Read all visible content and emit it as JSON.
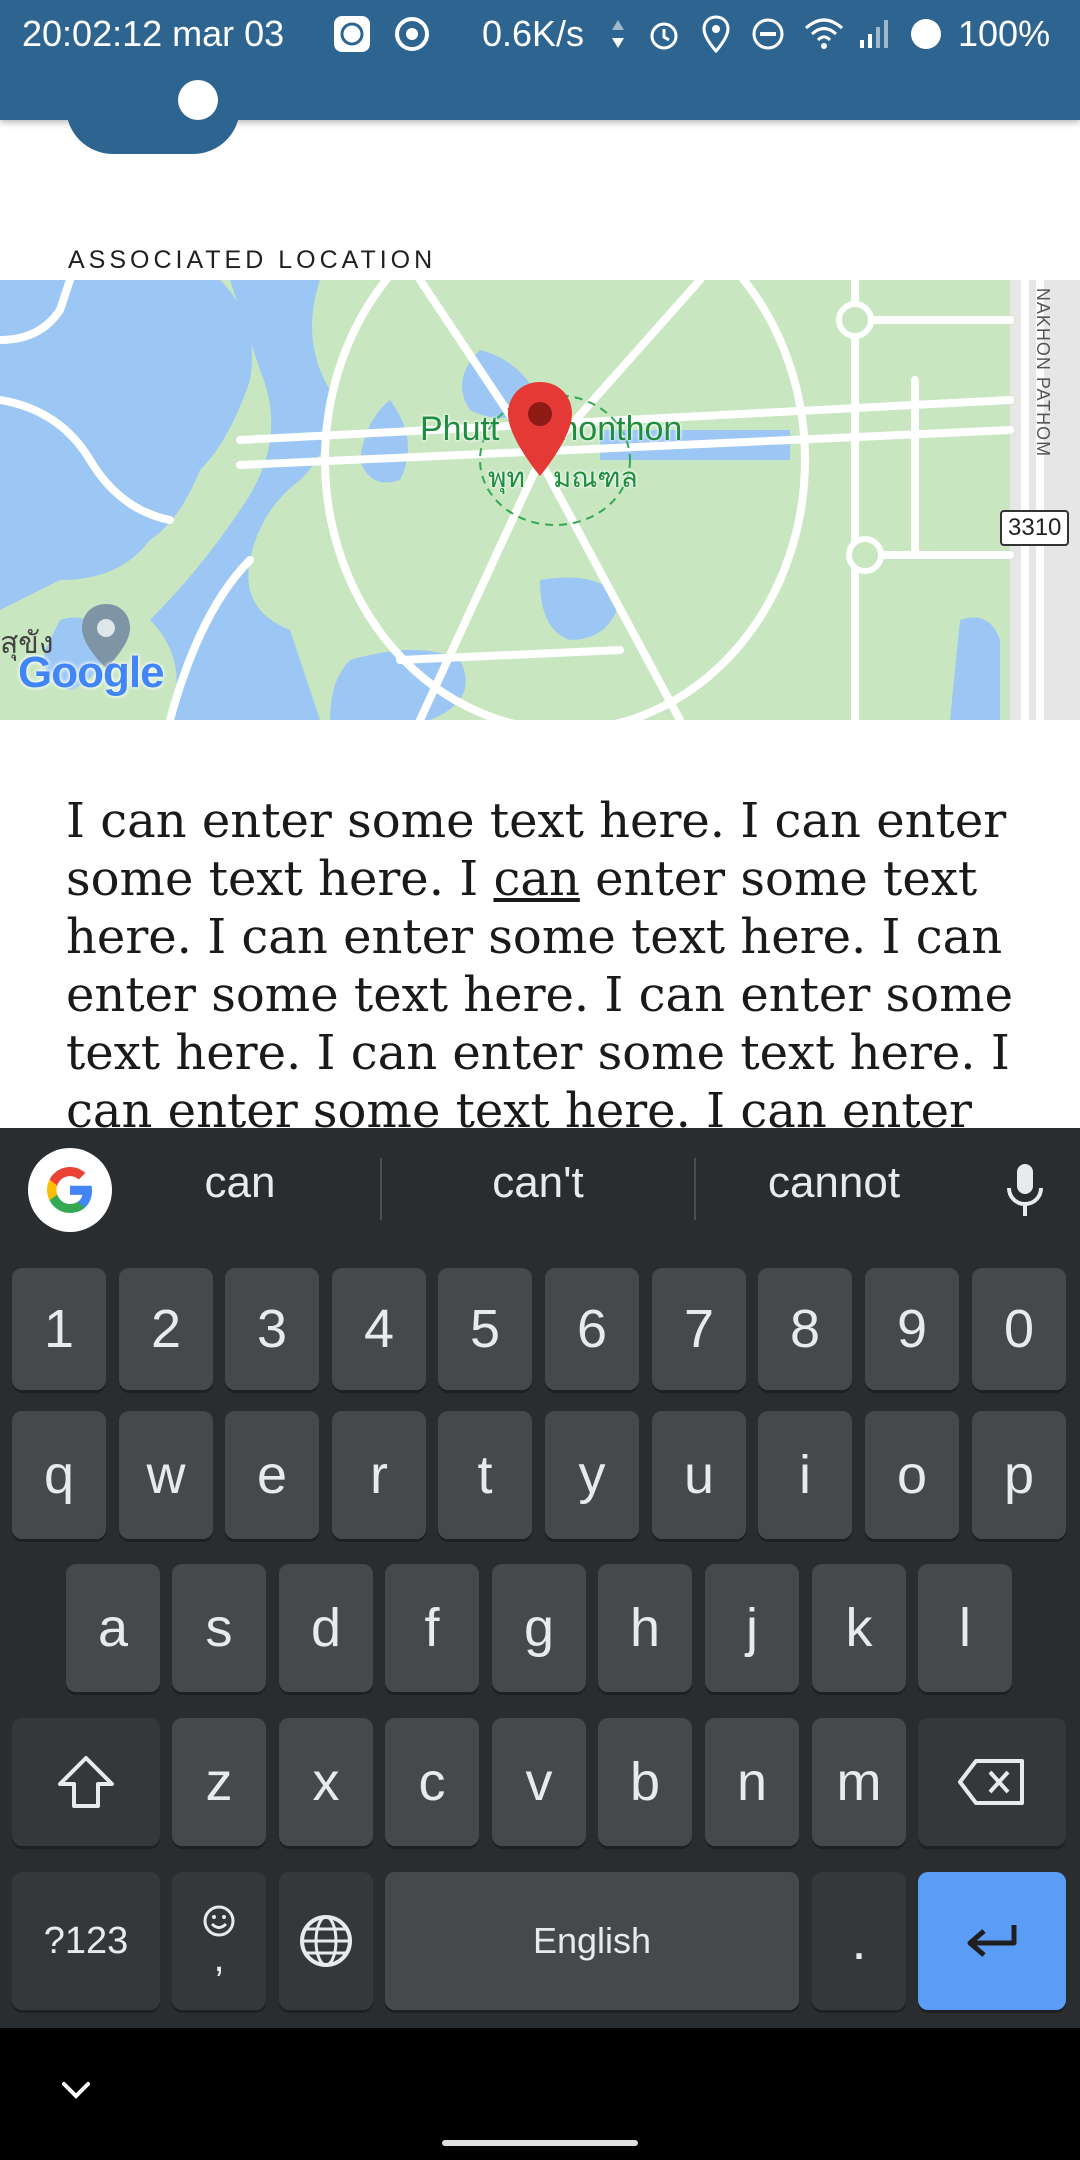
{
  "status_bar": {
    "time": "20:02:12 mar 03",
    "net_speed": "0.6K/s",
    "battery": "100%"
  },
  "section": {
    "label": "ASSOCIATED LOCATION"
  },
  "map": {
    "place_name": "Phutthamonthon",
    "place_name_visible_left": "Phutt",
    "place_name_visible_right": "nonthon",
    "place_name_thai_left": "พุท",
    "place_name_thai_right": "มณฑล",
    "edge_thai": "สุขัง",
    "road_label": "NAKHON PATHOM",
    "route_shield": "3310",
    "attribution": "Google"
  },
  "content": {
    "before_underline": "I can enter some text here. I can enter some text here. I ",
    "underlined_word": "can",
    "after_underline": " enter some text here. I can enter some text here. I can enter some text here. I can enter some text here. I can enter some text here. I can enter some text here. I can enter"
  },
  "keyboard": {
    "suggestions": [
      "can",
      "can't",
      "cannot"
    ],
    "row_numbers": [
      "1",
      "2",
      "3",
      "4",
      "5",
      "6",
      "7",
      "8",
      "9",
      "0"
    ],
    "row_top": [
      "q",
      "w",
      "e",
      "r",
      "t",
      "y",
      "u",
      "i",
      "o",
      "p"
    ],
    "row_middle": [
      "a",
      "s",
      "d",
      "f",
      "g",
      "h",
      "j",
      "k",
      "l"
    ],
    "row_bottom": [
      "z",
      "x",
      "c",
      "v",
      "b",
      "n",
      "m"
    ],
    "symbols_key": "?123",
    "comma_key": ",",
    "space_label": "English",
    "period_key": "."
  },
  "colors": {
    "app_bar": "#2e6590",
    "keyboard_bg": "#2a2d30",
    "key_bg": "#46494c",
    "enter_key": "#5b9cf6",
    "map_park": "#c8e6c0",
    "map_water": "#9cc7f5",
    "pin": "#e53935"
  },
  "icons": [
    "app-icon",
    "sync-icon",
    "alarm-icon",
    "location-icon",
    "dnd-icon",
    "wifi-icon",
    "signal-icon",
    "battery-icon",
    "google-g-icon",
    "mic-icon",
    "shift-icon",
    "backspace-icon",
    "emoji-icon",
    "globe-icon",
    "enter-icon",
    "chevron-down-icon"
  ]
}
